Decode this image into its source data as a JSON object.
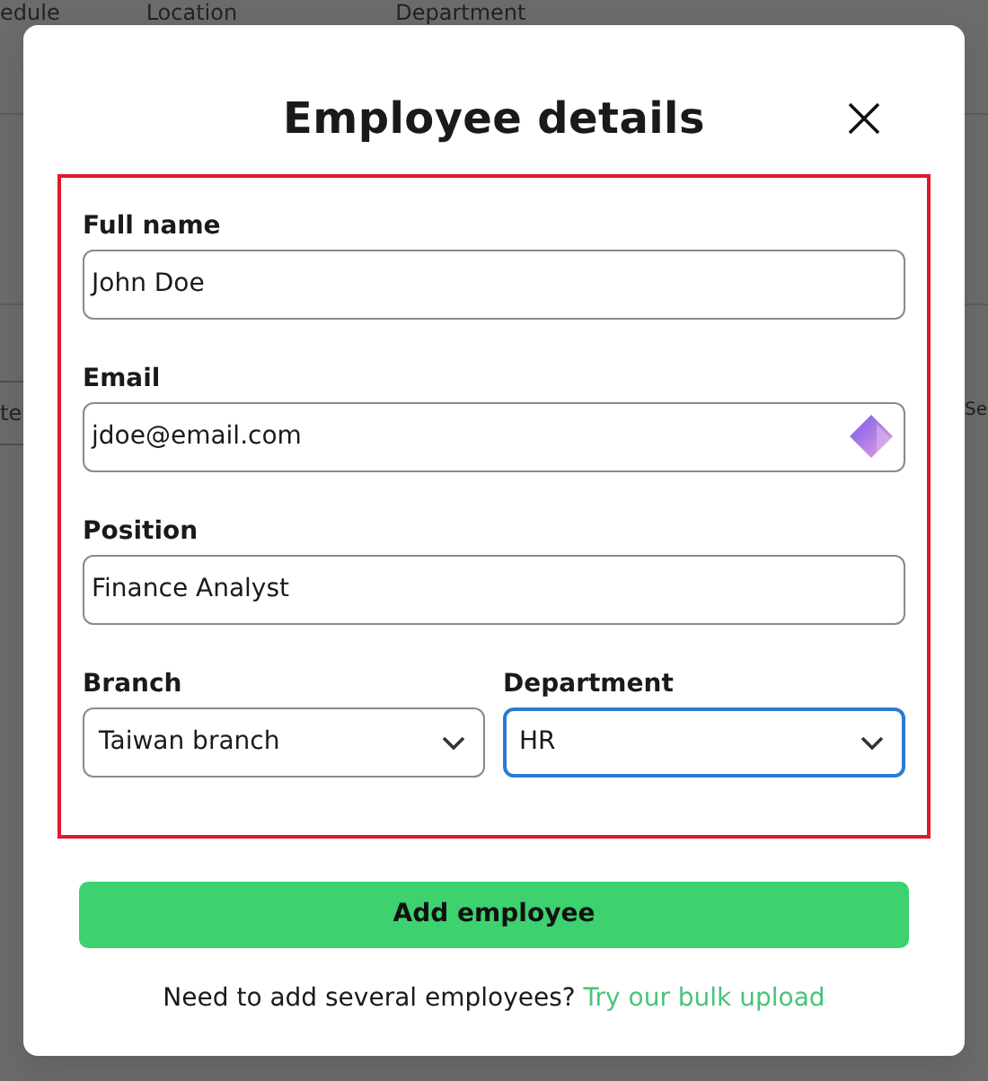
{
  "background": {
    "columns": [
      "edule",
      "Location",
      "Department"
    ],
    "row_cell": "te",
    "search_field": "Se"
  },
  "dialog": {
    "title": "Employee details",
    "highlight_frame": true,
    "fields": [
      {
        "kind": "text",
        "label": "Full name",
        "value": "John Doe",
        "focused": false,
        "has_icon": false
      },
      {
        "kind": "text",
        "label": "Email",
        "value": "jdoe@email.com",
        "focused": false,
        "has_icon": true
      },
      {
        "kind": "text",
        "label": "Position",
        "value": "Finance Analyst",
        "focused": false,
        "has_icon": false
      },
      {
        "kind": "select",
        "label": "Branch",
        "value": "Taiwan branch",
        "focused": false
      },
      {
        "kind": "select",
        "label": "Department",
        "value": "HR",
        "focused": true
      }
    ],
    "submit": "Add employee",
    "footer": {
      "text": "Need to add several employees?",
      "link": "Try our bulk upload"
    }
  }
}
